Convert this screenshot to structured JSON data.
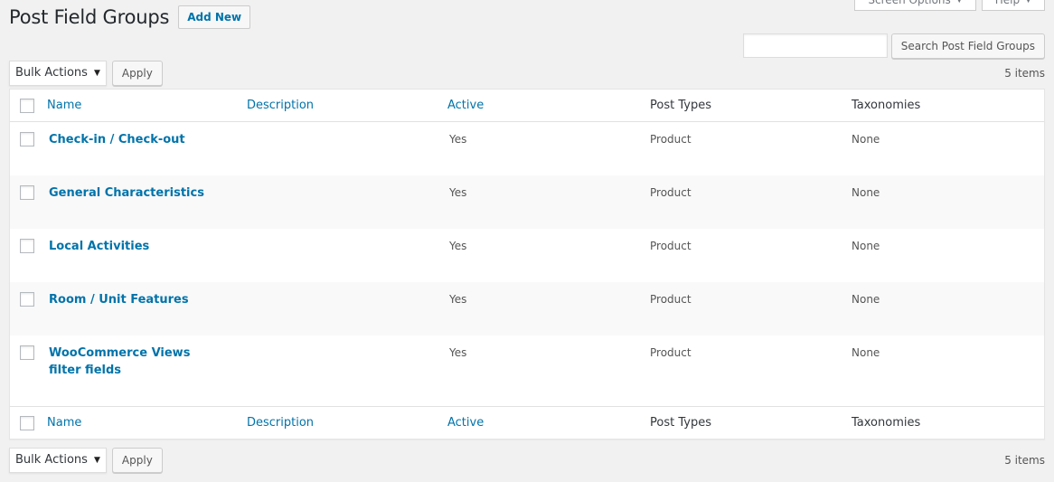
{
  "screen_meta": {
    "screen_options_label": "Screen Options",
    "help_label": "Help"
  },
  "header": {
    "title": "Post Field Groups",
    "add_new_label": "Add New"
  },
  "search": {
    "placeholder": "",
    "value": "",
    "button_label": "Search Post Field Groups"
  },
  "tablenav_top": {
    "bulk_actions": "Bulk Actions",
    "apply_label": "Apply",
    "items_count": "5 items"
  },
  "tablenav_bottom": {
    "bulk_actions": "Bulk Actions",
    "apply_label": "Apply",
    "items_count": "5 items"
  },
  "columns": {
    "name": "Name",
    "description": "Description",
    "active": "Active",
    "post_types": "Post Types",
    "taxonomies": "Taxonomies"
  },
  "rows": [
    {
      "name": "Check-in / Check-out",
      "description": "",
      "active": "Yes",
      "post_types": "Product",
      "taxonomies": "None"
    },
    {
      "name": "General Characteristics",
      "description": "",
      "active": "Yes",
      "post_types": "Product",
      "taxonomies": "None"
    },
    {
      "name": "Local Activities",
      "description": "",
      "active": "Yes",
      "post_types": "Product",
      "taxonomies": "None"
    },
    {
      "name": "Room / Unit Features",
      "description": "",
      "active": "Yes",
      "post_types": "Product",
      "taxonomies": "None"
    },
    {
      "name": "WooCommerce Views filter fields",
      "description": "",
      "active": "Yes",
      "post_types": "Product",
      "taxonomies": "None"
    }
  ],
  "colors": {
    "link": "#0073aa",
    "background": "#f1f1f1",
    "text": "#555555"
  }
}
